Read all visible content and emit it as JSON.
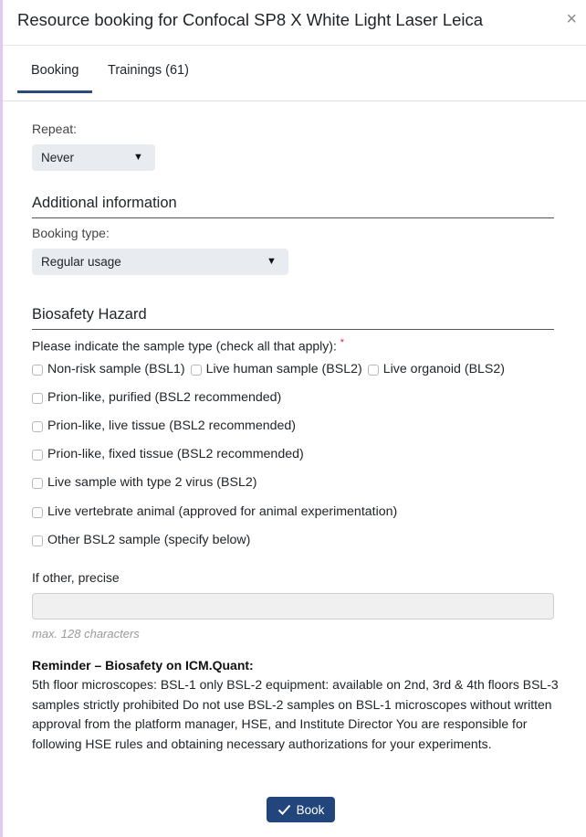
{
  "modal": {
    "title": "Resource booking for Confocal SP8 X White Light Laser Leica",
    "close_symbol": "×"
  },
  "tabs": [
    {
      "label": "Booking",
      "active": true
    },
    {
      "label": "Trainings (61)",
      "active": false
    }
  ],
  "repeat": {
    "label": "Repeat:",
    "value": "Never"
  },
  "additional_info": {
    "title": "Additional information",
    "booking_type_label": "Booking type:",
    "booking_type_value": "Regular usage"
  },
  "biosafety": {
    "title": "Biosafety Hazard",
    "question": "Please indicate the sample type (check all that apply):",
    "required_mark": "*",
    "options": [
      "Non-risk sample (BSL1)",
      "Live human sample (BSL2)",
      "Live organoid (BLS2)",
      "Prion-like, purified (BSL2 recommended)",
      "Prion-like, live tissue (BSL2 recommended)",
      "Prion-like, fixed tissue (BSL2 recommended)",
      "Live sample with type 2 virus (BSL2)",
      "Live vertebrate animal (approved for animal experimentation)",
      "Other BSL2 sample (specify below)"
    ]
  },
  "other": {
    "label": "If other, precise",
    "value": "",
    "hint": "max. 128 characters"
  },
  "reminder": {
    "title": "Reminder – Biosafety on ICM.Quant:",
    "body": "5th floor microscopes: BSL-1 only BSL-2 equipment: available on 2nd, 3rd & 4th floors BSL-3 samples strictly prohibited Do not use BSL-2 samples on BSL-1 microscopes without written approval from the platform manager, HSE, and Institute Director You are responsible for following HSE rules and obtaining necessary authorizations for your experiments."
  },
  "footer": {
    "book_label": "Book"
  },
  "icons": {
    "caret": "caret-down-icon",
    "check": "checkmark-icon",
    "close": "close-icon"
  },
  "colors": {
    "primary": "#22467c",
    "tab_underline": "#2a4c7a",
    "required": "#d9262c",
    "select_bg": "#e8ecf1"
  }
}
